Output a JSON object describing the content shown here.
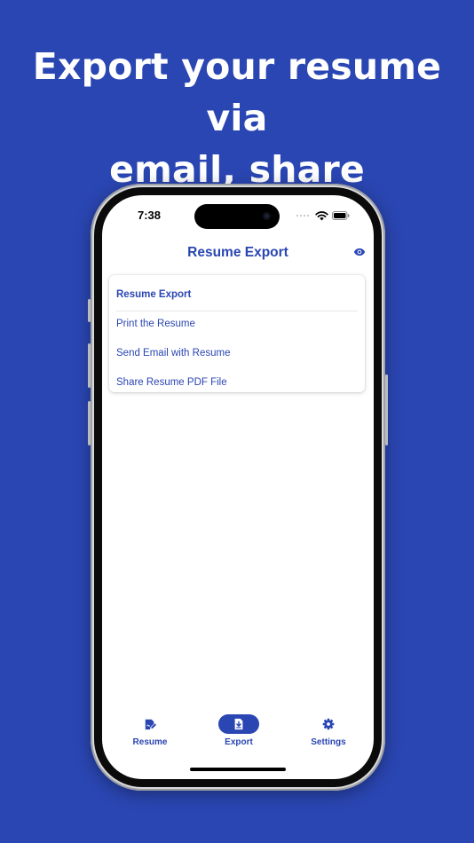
{
  "promo": {
    "headline_line1": "Export your resume via",
    "headline_line2": "email, share"
  },
  "status_bar": {
    "time": "7:38"
  },
  "nav": {
    "title": "Resume Export",
    "right_icon": "eye-icon"
  },
  "export_card": {
    "header": "Resume Export",
    "items": [
      {
        "label": "Print the Resume"
      },
      {
        "label": "Send Email with Resume"
      },
      {
        "label": "Share Resume PDF File"
      }
    ]
  },
  "tab_bar": {
    "tabs": [
      {
        "label": "Resume",
        "icon": "resume-edit-icon",
        "selected": false
      },
      {
        "label": "Export",
        "icon": "file-download-icon",
        "selected": true
      },
      {
        "label": "Settings",
        "icon": "gear-icon",
        "selected": false
      }
    ]
  },
  "colors": {
    "brand": "#2a46b2",
    "background": "#2a46b2",
    "screen": "#ffffff",
    "tab_selected_pill": "#2a46b2"
  }
}
